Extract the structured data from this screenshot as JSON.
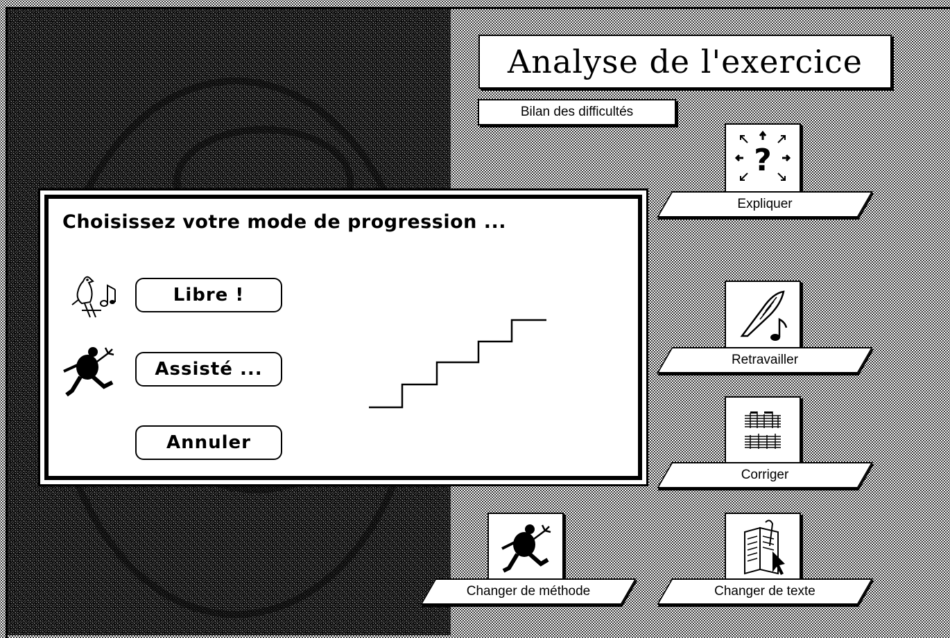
{
  "header": {
    "title": "Analyse de l'exercice",
    "bilan_label": "Bilan des difficultés"
  },
  "actions": {
    "explain": "Expliquer",
    "rework": "Retravailler",
    "correct": "Corriger",
    "change_method": "Changer de méthode",
    "change_text": "Changer de texte"
  },
  "dialog": {
    "title": "Choisissez votre mode de progression ...",
    "free_label": "Libre !",
    "assisted_label": "Assisté ...",
    "cancel_label": "Annuler"
  },
  "icons": {
    "explain": "question-arrows-icon",
    "rework": "quill-note-icon",
    "correct": "music-score-icon",
    "change_method": "running-man-icon",
    "change_text": "book-cursor-icon",
    "free": "bird-note-icon",
    "assisted": "running-man-icon",
    "progression": "staircase-icon"
  }
}
